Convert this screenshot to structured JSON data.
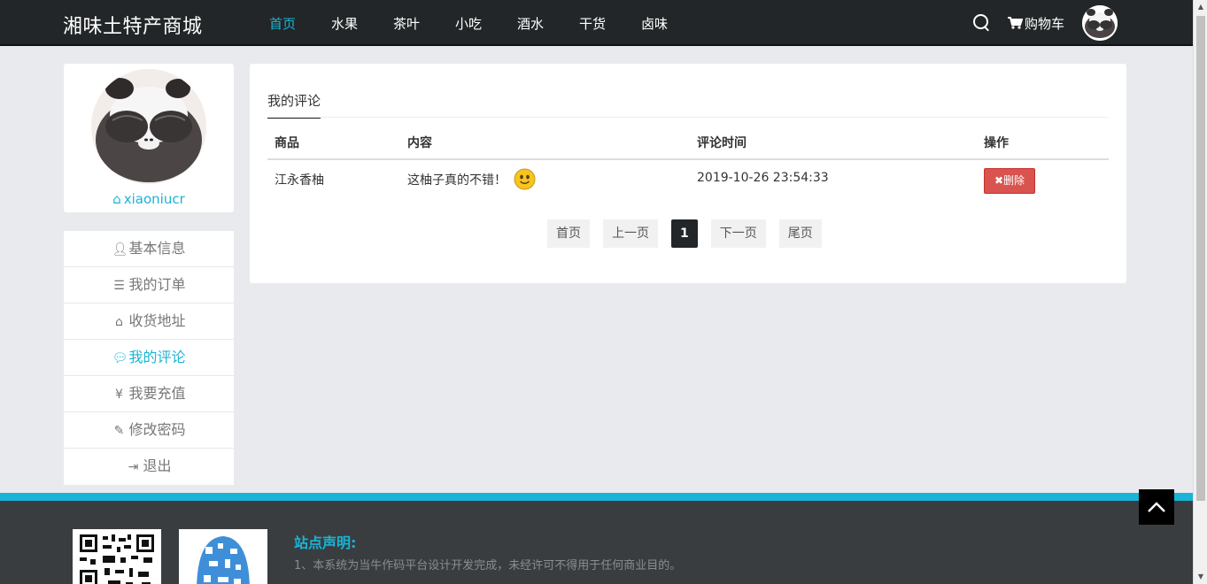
{
  "brand": {
    "title": "湘味土特产商城"
  },
  "nav": {
    "items": [
      {
        "label": "首页",
        "active": true
      },
      {
        "label": "水果"
      },
      {
        "label": "茶叶"
      },
      {
        "label": "小吃"
      },
      {
        "label": "酒水"
      },
      {
        "label": "干货"
      },
      {
        "label": "卤味"
      }
    ],
    "cart_label": "购物车",
    "accent": "#19b4d6"
  },
  "profile": {
    "username": "xiaoniucr"
  },
  "sidebar": {
    "items": [
      {
        "label": "基本信息",
        "icon": "user-icon"
      },
      {
        "label": "我的订单",
        "icon": "list-icon"
      },
      {
        "label": "收货地址",
        "icon": "home-icon"
      },
      {
        "label": "我的评论",
        "icon": "comment-icon",
        "active": true
      },
      {
        "label": "我要充值",
        "icon": "yen-icon"
      },
      {
        "label": "修改密码",
        "icon": "edit-icon"
      },
      {
        "label": "退出",
        "icon": "sign-out-icon"
      }
    ]
  },
  "panel": {
    "tab": "我的评论",
    "columns": [
      "商品",
      "内容",
      "评论时间",
      "操作"
    ],
    "rows": [
      {
        "product": "江永香柚",
        "content": "这柚子真的不错！",
        "time": "2019-10-26 23:54:33",
        "action": "删除"
      }
    ],
    "pager": {
      "first": "首页",
      "prev": "上一页",
      "current": "1",
      "next": "下一页",
      "last": "尾页"
    }
  },
  "footer": {
    "notice_title": "站点声明:",
    "notice_line1": "1、本系统为当牛作码平台设计开发完成，未经许可不得用于任何商业目的。"
  }
}
